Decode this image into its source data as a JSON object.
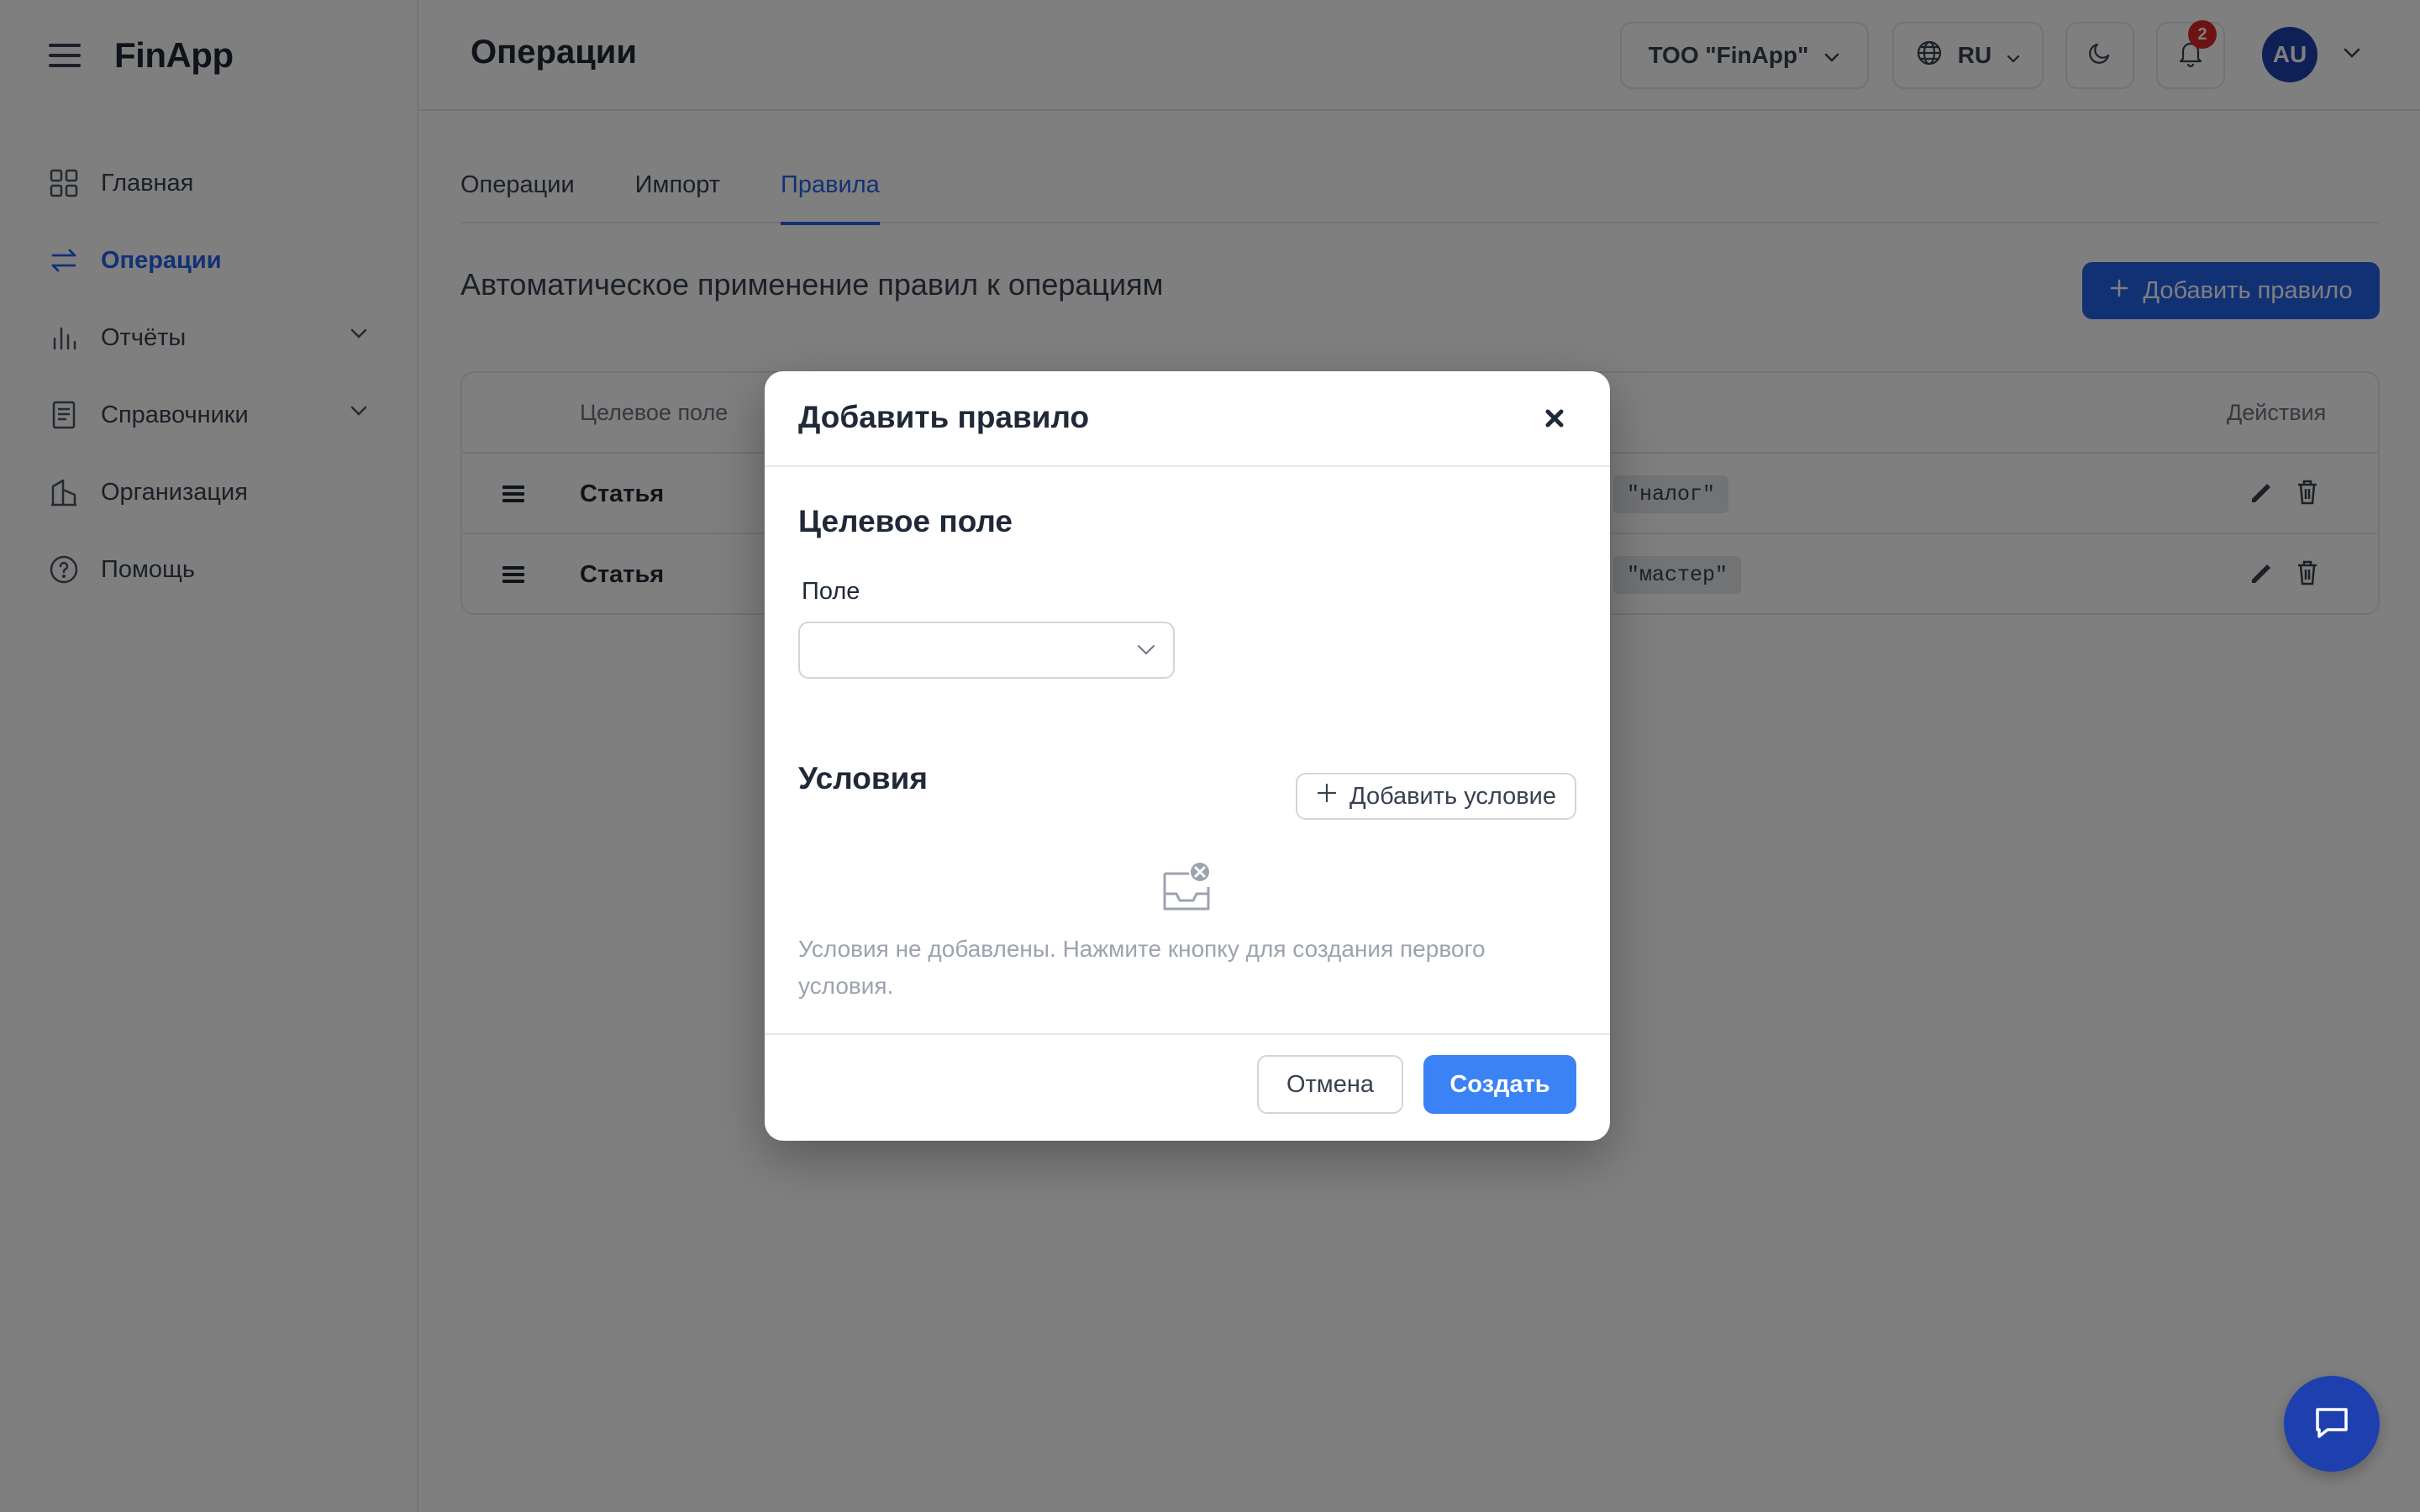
{
  "app": {
    "brand": "FinApp"
  },
  "sidebar": {
    "items": [
      {
        "label": "Главная",
        "icon": "grid-icon"
      },
      {
        "label": "Операции",
        "icon": "arrows-exchange-icon",
        "active": true
      },
      {
        "label": "Отчёты",
        "icon": "bar-chart-icon",
        "expandable": true
      },
      {
        "label": "Справочники",
        "icon": "book-icon",
        "expandable": true
      },
      {
        "label": "Организация",
        "icon": "building-icon"
      },
      {
        "label": "Помощь",
        "icon": "help-circle-icon"
      }
    ]
  },
  "header": {
    "title": "Операции",
    "org_selector": "ТОО \"FinApp\"",
    "language": "RU",
    "notifications_count": "2",
    "avatar_initials": "AU"
  },
  "tabs": [
    {
      "label": "Операции"
    },
    {
      "label": "Импорт"
    },
    {
      "label": "Правила",
      "active": true
    }
  ],
  "rules_page": {
    "section_title": "Автоматическое применение правил к операциям",
    "add_rule_label": "Добавить правило",
    "table": {
      "headers": {
        "field": "Целевое поле",
        "actions": "Действия"
      },
      "rows": [
        {
          "field": "Статья",
          "condition": "\"налог\""
        },
        {
          "field": "Статья",
          "condition": "\"мастер\""
        }
      ]
    }
  },
  "modal": {
    "title": "Добавить правило",
    "target_section_title": "Целевое поле",
    "field_label": "Поле",
    "field_value": "",
    "conditions_title": "Условия",
    "add_condition_label": "Добавить условие",
    "empty_text": "Условия не добавлены. Нажмите кнопку для создания первого условия.",
    "cancel_label": "Отмена",
    "create_label": "Создать"
  },
  "colors": {
    "accent": "#2563eb",
    "primary_button": "#3b82f6",
    "badge": "#dc2626",
    "overlay": "rgba(0,0,0,0.5)"
  }
}
